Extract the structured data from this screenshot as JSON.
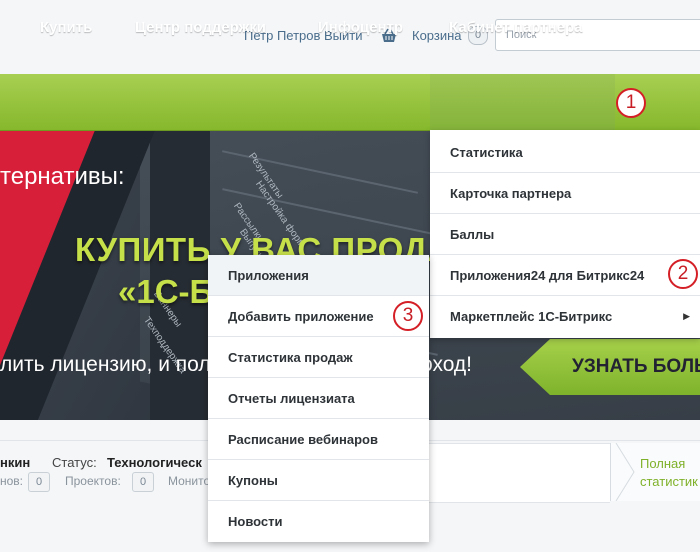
{
  "header": {
    "user_link": "Петр Петров Выйти",
    "cart_label": "Корзина",
    "cart_count": "0",
    "search_placeholder": "Поиск"
  },
  "nav": {
    "items": [
      "Купить",
      "Центр поддержки",
      "Инфоцентр",
      "Кабинет партнера"
    ]
  },
  "banner": {
    "alt_text": "тернативы:",
    "headline_1": "КУПИТЬ У ВАС ПРОДАЕ",
    "headline_2": "«1С-Б",
    "sub_left": "лить лицензию, и получ",
    "sub_right": "оход!",
    "cta": "УЗНАТЬ БОЛЬ",
    "sidebar_items": [
      "Результаты",
      "Настройка форм",
      "Рассылки",
      "Выпуски",
      "Отчеты",
      "Баннеры",
      "Техподдержка"
    ]
  },
  "partner_menu": {
    "items": [
      "Статистика",
      "Карточка партнера",
      "Баллы",
      "Приложения24 для Битрикс24",
      "Маркетплейс 1С-Битрикс"
    ]
  },
  "sub_menu": {
    "items": [
      "Приложения",
      "Добавить приложение",
      "Статистика продаж",
      "Отчеты лицензиата",
      "Расписание вебинаров",
      "Купоны",
      "Новости"
    ]
  },
  "profile": {
    "name_fragment": "нкин",
    "status_label": "Статус:",
    "status_value": "Технологическ",
    "count1_label": "нов:",
    "count1_value": "0",
    "count2_label": "Проектов:",
    "count2_value": "0",
    "count3_label": "Монито",
    "full_stat_1": "Полная",
    "full_stat_2": "статистик"
  },
  "callouts": [
    "1",
    "2",
    "3"
  ],
  "colors": {
    "nav_green": "#96c43e",
    "callout_red": "#d41f26",
    "link_blue": "#4a6d8c",
    "banner_lime": "#c6e04a"
  }
}
